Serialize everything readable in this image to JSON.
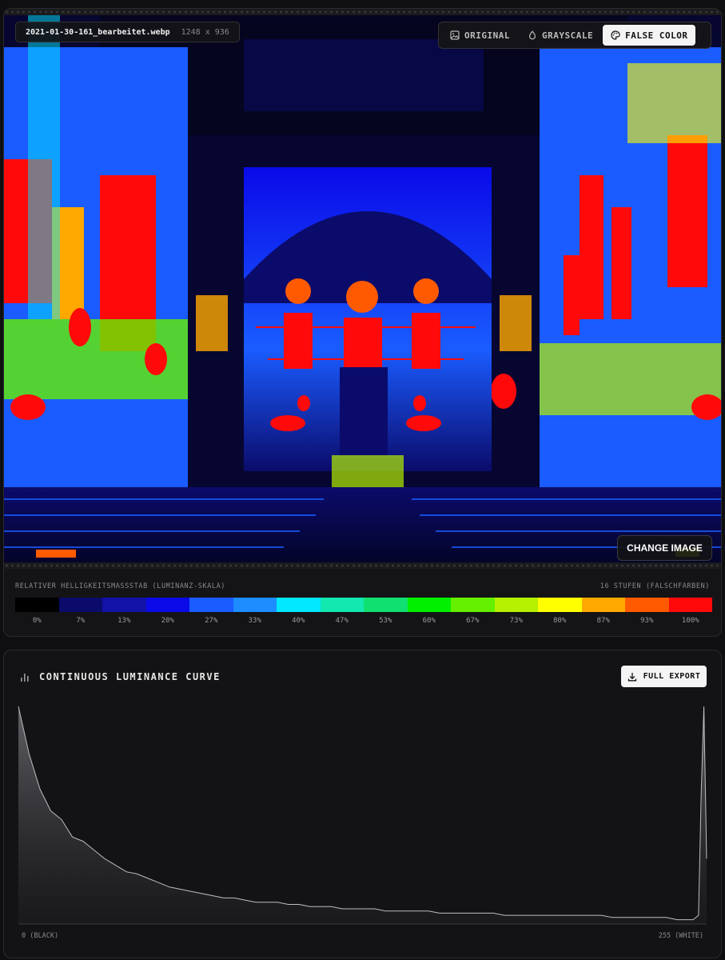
{
  "file": {
    "name": "2021-01-30-161_bearbeitet.webp",
    "dimensions": "1248 x 936"
  },
  "modes": [
    {
      "label": "ORIGINAL",
      "icon": "image-icon",
      "active": false
    },
    {
      "label": "GRAYSCALE",
      "icon": "droplet-icon",
      "active": false
    },
    {
      "label": "FALSE COLOR",
      "icon": "palette-icon",
      "active": true
    }
  ],
  "change_image_label": "CHANGE IMAGE",
  "scale": {
    "title": "RELATIVER HELLIGKEITSMASSSTAB (LUMINANZ-SKALA)",
    "steps_label": "16 STUFEN (FALSCHFARBEN)",
    "colors": [
      "#000000",
      "#0b0b6b",
      "#1212a8",
      "#0a0ae8",
      "#1a5cff",
      "#1d8cff",
      "#00e8ff",
      "#12e8b0",
      "#10e070",
      "#00f000",
      "#64f000",
      "#b4f000",
      "#ffff00",
      "#ffa800",
      "#ff5a00",
      "#ff0a0a"
    ],
    "labels": [
      "0%",
      "7%",
      "13%",
      "20%",
      "27%",
      "33%",
      "40%",
      "47%",
      "53%",
      "60%",
      "67%",
      "73%",
      "80%",
      "87%",
      "93%",
      "100%"
    ]
  },
  "curve": {
    "title": "CONTINUOUS LUMINANCE CURVE",
    "export_label": "FULL EXPORT",
    "axis_min_label": "0 (BLACK)",
    "axis_max_label": "255 (WHITE)"
  },
  "chart_data": {
    "type": "area",
    "title": "CONTINUOUS LUMINANCE CURVE",
    "xlabel": "",
    "ylabel": "",
    "xlim": [
      0,
      255
    ],
    "x": [
      0,
      4,
      8,
      12,
      16,
      20,
      24,
      28,
      32,
      36,
      40,
      44,
      48,
      52,
      56,
      60,
      64,
      68,
      72,
      76,
      80,
      84,
      88,
      92,
      96,
      100,
      104,
      108,
      112,
      116,
      120,
      124,
      128,
      132,
      136,
      140,
      144,
      148,
      152,
      156,
      160,
      164,
      168,
      172,
      176,
      180,
      184,
      188,
      192,
      196,
      200,
      204,
      208,
      212,
      216,
      220,
      224,
      228,
      232,
      236,
      240,
      244,
      248,
      250,
      252,
      253,
      254,
      255
    ],
    "y": [
      100,
      78,
      62,
      52,
      48,
      40,
      38,
      34,
      30,
      27,
      24,
      23,
      21,
      19,
      17,
      16,
      15,
      14,
      13,
      12,
      12,
      11,
      10,
      10,
      10,
      9,
      9,
      8,
      8,
      8,
      7,
      7,
      7,
      7,
      6,
      6,
      6,
      6,
      6,
      5,
      5,
      5,
      5,
      5,
      5,
      4,
      4,
      4,
      4,
      4,
      4,
      4,
      4,
      4,
      4,
      3,
      3,
      3,
      3,
      3,
      3,
      2,
      2,
      2,
      4,
      60,
      100,
      30
    ]
  }
}
